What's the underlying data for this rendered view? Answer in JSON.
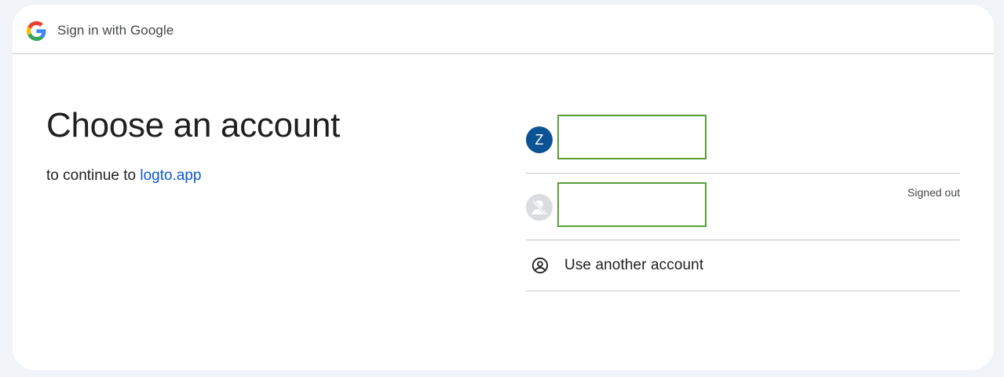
{
  "header": {
    "title": "Sign in with Google",
    "logo_icon": "google-g-icon"
  },
  "main": {
    "title": "Choose an account",
    "subtitle_prefix": "to continue to ",
    "app_link": "logto.app"
  },
  "accounts": [
    {
      "avatar_letter": "Z",
      "avatar_color": "#0b5394",
      "status": ""
    },
    {
      "avatar_letter": "",
      "avatar_icon": "signed-out-user-icon",
      "status": "Signed out"
    }
  ],
  "another_account": {
    "label": "Use another account",
    "icon": "account-circle-icon"
  },
  "colors": {
    "background": "#f0f4f9",
    "card": "#ffffff",
    "link": "#0b57d0",
    "divider": "#c4c7c5",
    "highlight_box": "#5a9e3a"
  }
}
